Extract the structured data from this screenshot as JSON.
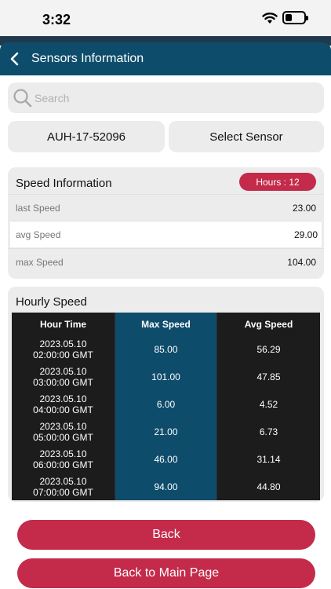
{
  "status": {
    "time": "3:32"
  },
  "header": {
    "title": "Sensors Information"
  },
  "search": {
    "placeholder": "Search"
  },
  "selectors": {
    "vehicle": "AUH-17-52096",
    "sensor": "Select Sensor"
  },
  "speed_info": {
    "title": "Speed Information",
    "hours_badge": "Hours : 12",
    "rows": [
      {
        "label": "last Speed",
        "value": "23.00"
      },
      {
        "label": "avg Speed",
        "value": "29.00"
      },
      {
        "label": "max Speed",
        "value": "104.00"
      }
    ]
  },
  "hourly": {
    "title": "Hourly Speed",
    "headers": [
      "Hour Time",
      "Max Speed",
      "Avg Speed"
    ],
    "rows": [
      {
        "time": "2023.05.10\n02:00:00 GMT",
        "max": "85.00",
        "avg": "56.29"
      },
      {
        "time": "2023.05.10\n03:00:00 GMT",
        "max": "101.00",
        "avg": "47.85"
      },
      {
        "time": "2023.05.10\n04:00:00 GMT",
        "max": "6.00",
        "avg": "4.52"
      },
      {
        "time": "2023.05.10\n05:00:00 GMT",
        "max": "21.00",
        "avg": "6.73"
      },
      {
        "time": "2023.05.10\n06:00:00 GMT",
        "max": "46.00",
        "avg": "31.14"
      },
      {
        "time": "2023.05.10\n07:00:00 GMT",
        "max": "94.00",
        "avg": "44.80"
      }
    ]
  },
  "actions": {
    "back": "Back",
    "main": "Back to Main Page"
  },
  "colors": {
    "header": "#0e4c6b",
    "accent": "#c42a4a",
    "table_dark": "#1c1c1c"
  }
}
